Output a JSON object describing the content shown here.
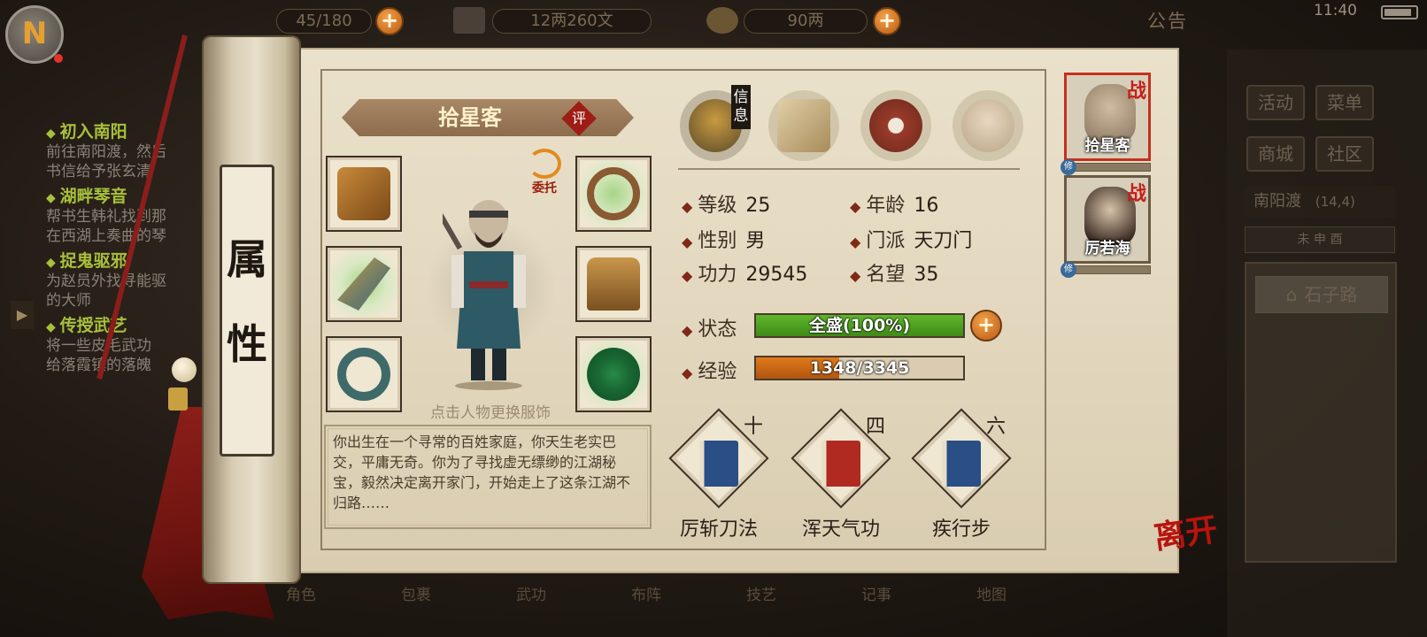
{
  "hud": {
    "left_counter": "45/180",
    "silver": "12两260文",
    "gold": "90两",
    "notice": "公告",
    "time": "11:40"
  },
  "quests": [
    {
      "title": "初入南阳",
      "desc": [
        "前往南阳渡，然后",
        "书信给予张玄清"
      ]
    },
    {
      "title": "湖畔琴音",
      "desc": [
        "帮书生韩礼找到那",
        "在西湖上奏曲的琴"
      ]
    },
    {
      "title": "捉鬼驱邪",
      "desc": [
        "为赵员外找寻能驱",
        "的大师"
      ]
    },
    {
      "title": "传授武艺",
      "desc": [
        "将一些皮毛武功",
        "给落霞镇的落魄"
      ]
    }
  ],
  "right_menu": {
    "buttons": [
      "活动",
      "菜单",
      "商城",
      "社区"
    ],
    "location": "南阳渡",
    "coords": "(14,4)",
    "time_bar": "未  申  酉",
    "place": "石子路"
  },
  "bottom_bar": [
    "角色",
    "包裹",
    "武功",
    "布阵",
    "技艺",
    "记事",
    "地图"
  ],
  "scroll_label": "属性",
  "character": {
    "name": "拾星客",
    "rate_label": "评",
    "commission_label": "委托",
    "change_hint": "点击人物更换服饰",
    "bio": "你出生在一个寻常的百姓家庭，你天生老实巴交，平庸无奇。你为了寻找虚无缥缈的江湖秘宝，毅然决定离开家门，开始走上了这条江湖不归路……"
  },
  "tabs": {
    "active_label": "信息"
  },
  "stats": {
    "level_label": "等级",
    "level": "25",
    "age_label": "年龄",
    "age": "16",
    "gender_label": "性别",
    "gender": "男",
    "sect_label": "门派",
    "sect": "天刀门",
    "power_label": "功力",
    "power": "29545",
    "fame_label": "名望",
    "fame": "35",
    "status_label": "状态",
    "status_text": "全盛(100%)",
    "status_fraction": 1.0,
    "exp_label": "经验",
    "exp_text": "1348/3345",
    "exp_current": 1348,
    "exp_max": 3345
  },
  "skills": [
    {
      "name": "厉斩刀法",
      "level": "十",
      "color": "#2a4e86"
    },
    {
      "name": "浑天气功",
      "level": "四",
      "color": "#b02a22"
    },
    {
      "name": "疾行步",
      "level": "六",
      "color": "#2a4e86"
    }
  ],
  "party": [
    {
      "name": "拾星客",
      "tag": "战",
      "pin": "修"
    },
    {
      "name": "厉若海",
      "tag": "战",
      "pin": "修"
    }
  ],
  "leave_label": "离开",
  "colors": {
    "status_bar": "#5fb82a",
    "exp_bar": "#e07a1a",
    "accent_red": "#9e1d16"
  }
}
